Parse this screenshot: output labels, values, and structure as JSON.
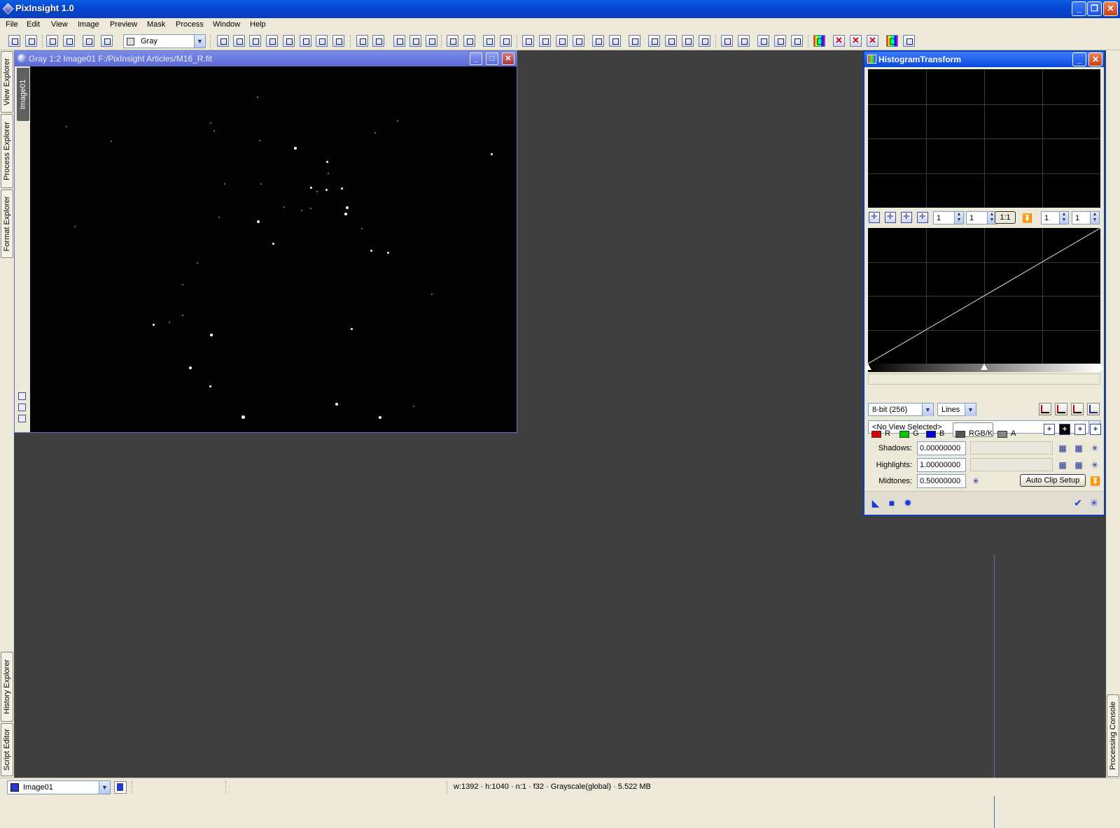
{
  "app": {
    "title": "PixInsight 1.0"
  },
  "menu": [
    "File",
    "Edit",
    "View",
    "Image",
    "Preview",
    "Mask",
    "Process",
    "Window",
    "Help"
  ],
  "toolbar": {
    "colorspace": "Gray"
  },
  "side_tabs": {
    "left_top": [
      "View Explorer",
      "Process Explorer",
      "Format Explorer"
    ],
    "left_bottom": [
      "History Explorer",
      "Script Editor"
    ],
    "right": "Processing Console"
  },
  "image_window": {
    "title": "Gray 1:2 Image01 F:/PixInsight Articles/M16_R.fit",
    "tab_label": "Image01"
  },
  "histogram": {
    "title": "HistogramTransform",
    "zoom_h": "1",
    "zoom_v": "1",
    "ratio": "1:1",
    "zoom_h2": "1",
    "zoom_v2": "1",
    "resolution": "8-bit (256)",
    "graph_style": "Lines",
    "view_selector": "<No View Selected>",
    "channels": [
      {
        "label": "R",
        "color": "#e00000"
      },
      {
        "label": "G",
        "color": "#00d000"
      },
      {
        "label": "B",
        "color": "#0000e0"
      },
      {
        "label": "RGB/K",
        "color": "#555555"
      },
      {
        "label": "A",
        "color": "#888888"
      }
    ],
    "shadows_label": "Shadows:",
    "shadows": "0.00000000",
    "highlights_label": "Highlights:",
    "highlights": "1.00000000",
    "midtones_label": "Midtones:",
    "midtones": "0.50000000",
    "auto_clip_label": "Auto Clip Setup",
    "curve": {
      "shadows": 0.0,
      "midtones": 0.5,
      "highlights": 1.0
    }
  },
  "status": {
    "view": "Image01",
    "info": "w:1392 · h:1040 · n:1 · f32 · Grayscale(global) · 5.522 MB"
  }
}
